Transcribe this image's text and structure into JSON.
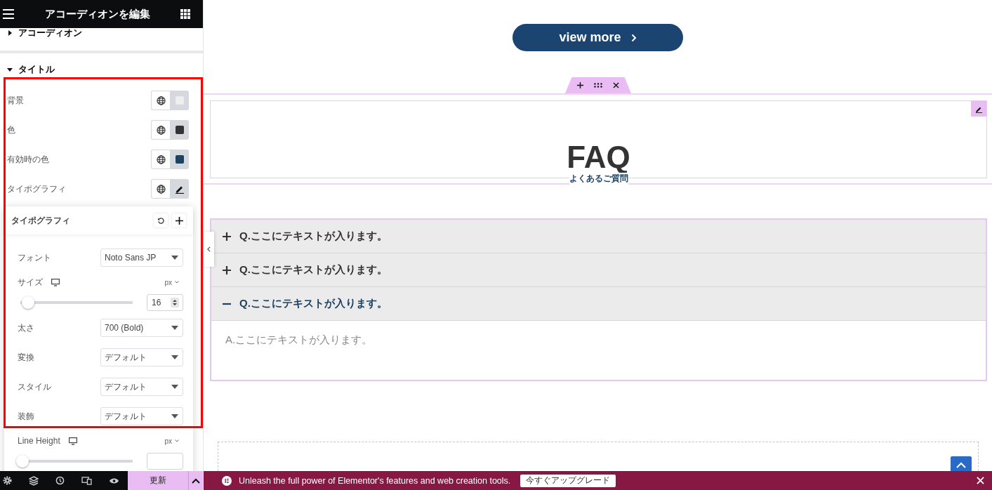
{
  "editor": {
    "title": "アコーディオンを編集",
    "sections": [
      {
        "label": "アコーディオン",
        "expanded": false
      },
      {
        "label": "タイトル",
        "expanded": true
      }
    ],
    "controls": [
      {
        "label": "背景",
        "kind": "swatch",
        "color": "#eeeeee"
      },
      {
        "label": "色",
        "kind": "swatch",
        "color": "#333333"
      },
      {
        "label": "有効時の色",
        "kind": "swatch",
        "color": "#1c4263"
      },
      {
        "label": "タイポグラフィ",
        "kind": "edit"
      }
    ],
    "typography": {
      "title": "タイポグラフィ",
      "fields": [
        {
          "kind": "select",
          "label": "フォント",
          "value": "Noto Sans JP"
        },
        {
          "kind": "slider",
          "label": "サイズ",
          "unit": "px",
          "value": "16",
          "level": 0.05
        },
        {
          "kind": "select",
          "label": "太さ",
          "value": "700 (Bold)"
        },
        {
          "kind": "select",
          "label": "変換",
          "value": "デフォルト"
        },
        {
          "kind": "select",
          "label": "スタイル",
          "value": "デフォルト"
        },
        {
          "kind": "select",
          "label": "装飾",
          "value": "デフォルト"
        },
        {
          "kind": "slider",
          "label": "Line Height",
          "unit": "px",
          "level": 0
        }
      ]
    },
    "update_button": "更新"
  },
  "canvas": {
    "view_more": "view more",
    "heading": "FAQ",
    "subheading": "よくあるご質問",
    "accordion": [
      {
        "title": "Q.ここにテキストが入ります。",
        "expanded": false
      },
      {
        "title": "Q.ここにテキストが入ります。",
        "expanded": false
      },
      {
        "title": "Q.ここにテキストが入ります。",
        "expanded": true,
        "content": "A.ここにテキストが入ります。"
      }
    ]
  },
  "promo": {
    "text": "Unleash the full power of Elementor's features and web creation tools.",
    "button": "今すぐアップグレード"
  }
}
